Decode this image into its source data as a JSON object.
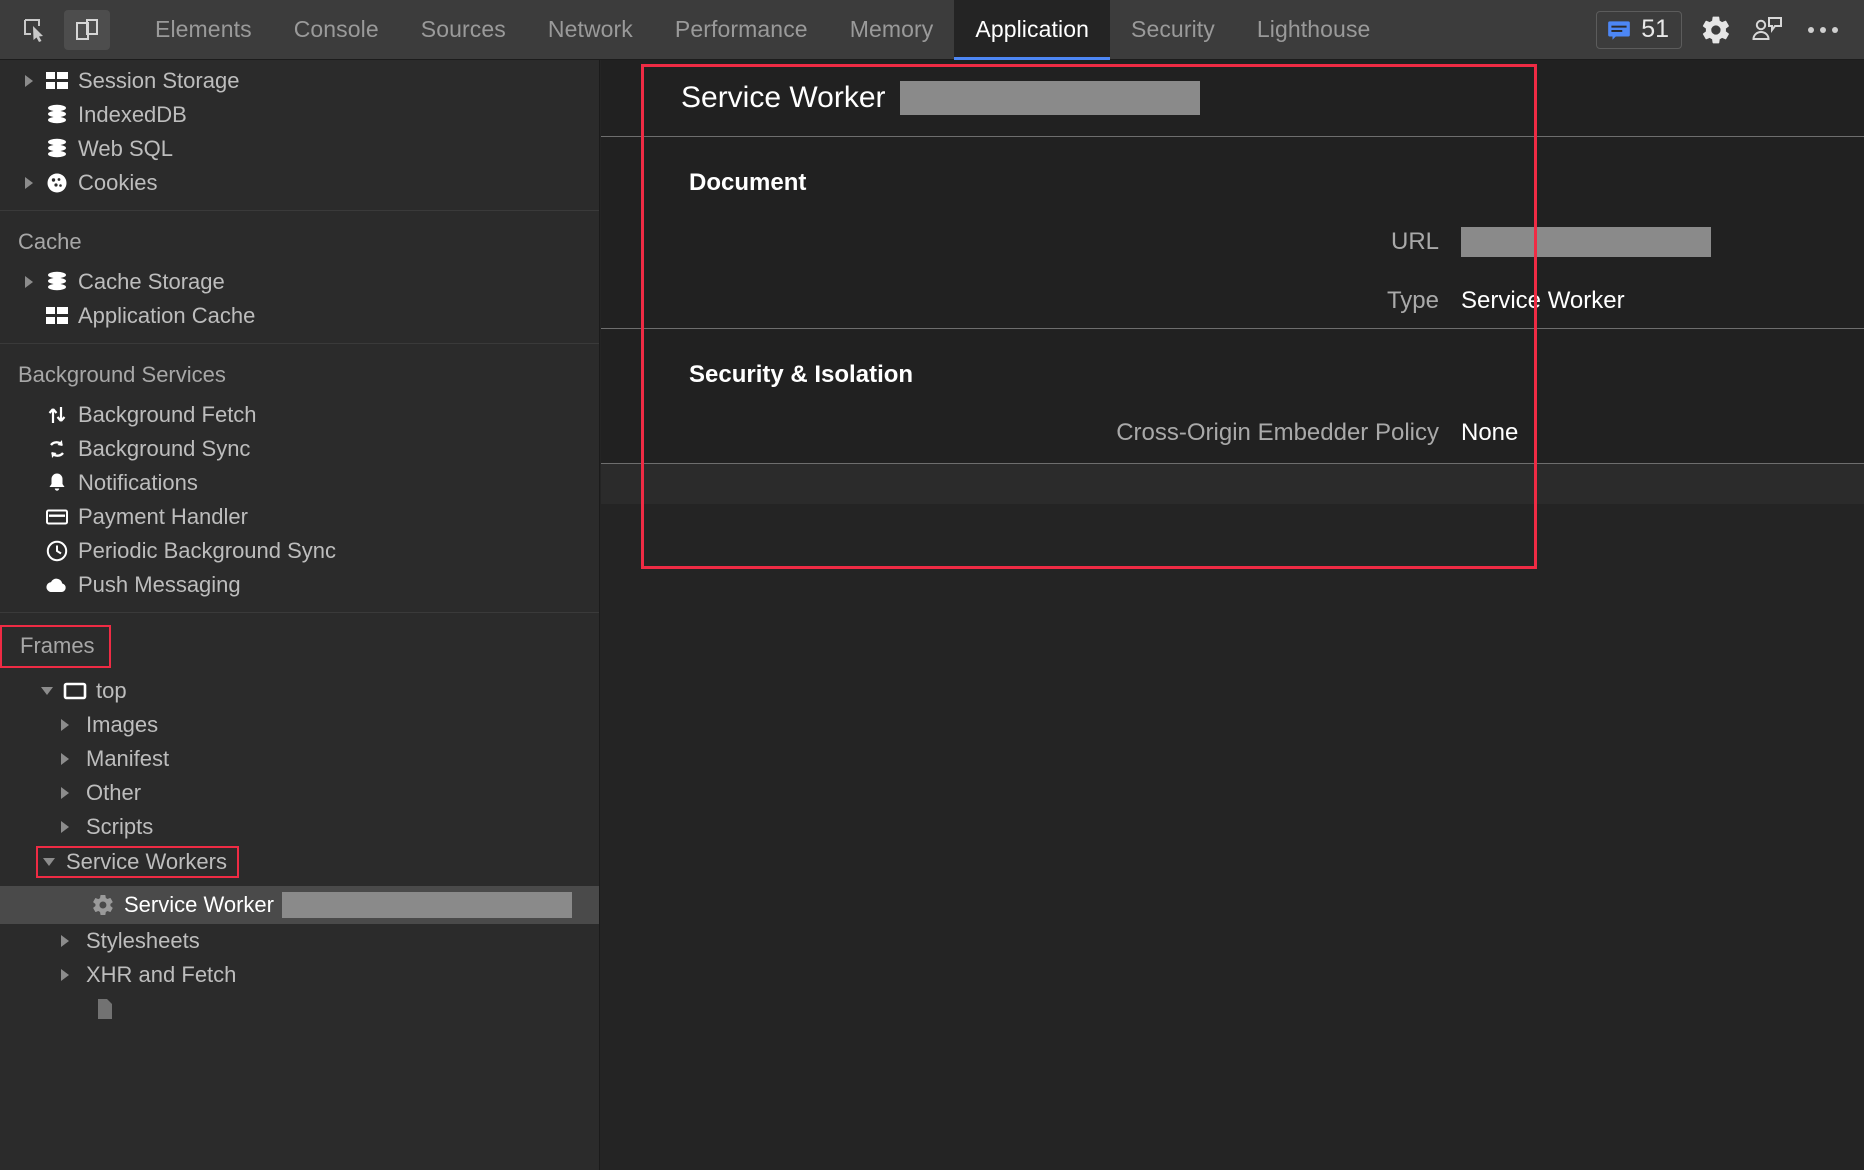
{
  "toolbar": {
    "inspect_icon": "inspect-cursor-icon",
    "device_icon": "device-toolbar-icon",
    "tabs": [
      {
        "label": "Elements",
        "selected": false
      },
      {
        "label": "Console",
        "selected": false
      },
      {
        "label": "Sources",
        "selected": false
      },
      {
        "label": "Network",
        "selected": false
      },
      {
        "label": "Performance",
        "selected": false
      },
      {
        "label": "Memory",
        "selected": false
      },
      {
        "label": "Application",
        "selected": true
      },
      {
        "label": "Security",
        "selected": false
      },
      {
        "label": "Lighthouse",
        "selected": false
      }
    ],
    "message_count": "51",
    "message_icon": "message-icon",
    "settings_icon": "gear-icon",
    "feedback_icon": "feedback-person-icon",
    "more_icon": "more-options-icon",
    "accent_blue": "#4d87f5"
  },
  "sidebar": {
    "storage_items": [
      {
        "label": "Session Storage",
        "icon": "table-storage-icon",
        "arrow": "right"
      },
      {
        "label": "IndexedDB",
        "icon": "database-icon",
        "arrow": "none"
      },
      {
        "label": "Web SQL",
        "icon": "database-icon",
        "arrow": "none"
      },
      {
        "label": "Cookies",
        "icon": "cookie-icon",
        "arrow": "right"
      }
    ],
    "cache_title": "Cache",
    "cache_items": [
      {
        "label": "Cache Storage",
        "icon": "database-icon",
        "arrow": "right"
      },
      {
        "label": "Application Cache",
        "icon": "table-storage-icon",
        "arrow": "none"
      }
    ],
    "background_title": "Background Services",
    "background_items": [
      {
        "label": "Background Fetch",
        "icon": "up-down-arrows-icon",
        "arrow": "none"
      },
      {
        "label": "Background Sync",
        "icon": "sync-icon",
        "arrow": "none"
      },
      {
        "label": "Notifications",
        "icon": "bell-icon",
        "arrow": "none"
      },
      {
        "label": "Payment Handler",
        "icon": "credit-card-icon",
        "arrow": "none"
      },
      {
        "label": "Periodic Background Sync",
        "icon": "clock-icon",
        "arrow": "none"
      },
      {
        "label": "Push Messaging",
        "icon": "cloud-icon",
        "arrow": "none"
      }
    ],
    "frames_title": "Frames",
    "frames_top": {
      "label": "top",
      "icon": "frame-icon",
      "arrow": "down"
    },
    "frame_children": [
      {
        "label": "Images",
        "arrow": "right"
      },
      {
        "label": "Manifest",
        "arrow": "right"
      },
      {
        "label": "Other",
        "arrow": "right"
      },
      {
        "label": "Scripts",
        "arrow": "right"
      }
    ],
    "service_workers_label": "Service Workers",
    "service_worker_row": {
      "label": "Service Worker",
      "icon": "gear-icon"
    },
    "frame_children_after": [
      {
        "label": "Stylesheets",
        "arrow": "right"
      },
      {
        "label": "XHR and Fetch",
        "arrow": "right"
      }
    ],
    "highlight_color": "#ef2b44"
  },
  "main": {
    "header_title": "Service Worker",
    "document": {
      "section_title": "Document",
      "url_label": "URL",
      "type_label": "Type",
      "type_value": "Service Worker"
    },
    "security": {
      "section_title": "Security & Isolation",
      "coep_label": "Cross-Origin Embedder Policy",
      "coep_value": "None"
    }
  }
}
